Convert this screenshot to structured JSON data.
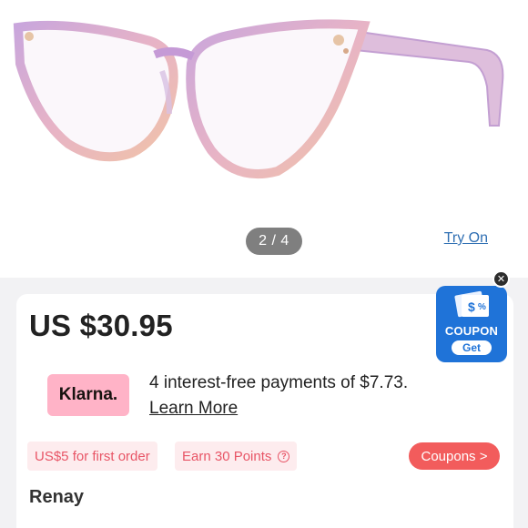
{
  "gallery": {
    "pager": "2 / 4",
    "try_on": "Try On",
    "product_image": "cat-eye-glasses-icon"
  },
  "product": {
    "price": "US $30.95",
    "name": "Renay"
  },
  "klarna": {
    "logo": "Klarna.",
    "text": "4 interest-free payments of $7.73.",
    "learn_more": "Learn More"
  },
  "promos": {
    "first_order": "US$5 for first order",
    "points": "Earn 30 Points",
    "points_help_icon": "?",
    "coupons_button": "Coupons >"
  },
  "coupon_widget": {
    "label": "COUPON",
    "get": "Get",
    "close_icon": "✕"
  },
  "colors": {
    "klarna_pink": "#ffb3c7",
    "promo_red": "#e85566",
    "coupons_btn": "#f25c5c",
    "coupon_blue": "#1f73d8"
  }
}
